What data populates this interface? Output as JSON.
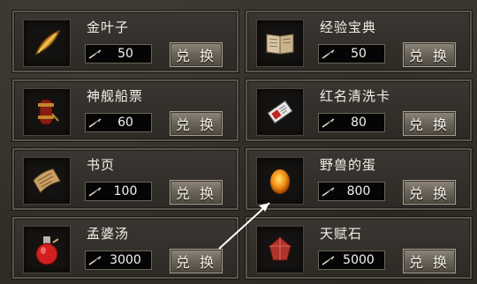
{
  "items": [
    {
      "name": "金叶子",
      "price": "50",
      "button": "兑 换",
      "icon": "gold-leaf-icon"
    },
    {
      "name": "经验宝典",
      "price": "50",
      "button": "兑 换",
      "icon": "experience-book-icon"
    },
    {
      "name": "神舰船票",
      "price": "60",
      "button": "兑 换",
      "icon": "ship-ticket-icon"
    },
    {
      "name": "红名清洗卡",
      "price": "80",
      "button": "兑 换",
      "icon": "red-name-card-icon"
    },
    {
      "name": "书页",
      "price": "100",
      "button": "兑 换",
      "icon": "book-page-icon"
    },
    {
      "name": "野兽的蛋",
      "price": "800",
      "button": "兑 换",
      "icon": "beast-egg-icon"
    },
    {
      "name": "孟婆汤",
      "price": "3000",
      "button": "兑 换",
      "icon": "potion-icon"
    },
    {
      "name": "天赋石",
      "price": "5000",
      "button": "兑 换",
      "icon": "talent-stone-icon"
    }
  ],
  "currency_icon": "feather-currency-icon",
  "colors": {
    "panel": "#2d2a26",
    "border": "#5b544a",
    "text": "#f2f0e8",
    "price_bg": "#050505"
  }
}
